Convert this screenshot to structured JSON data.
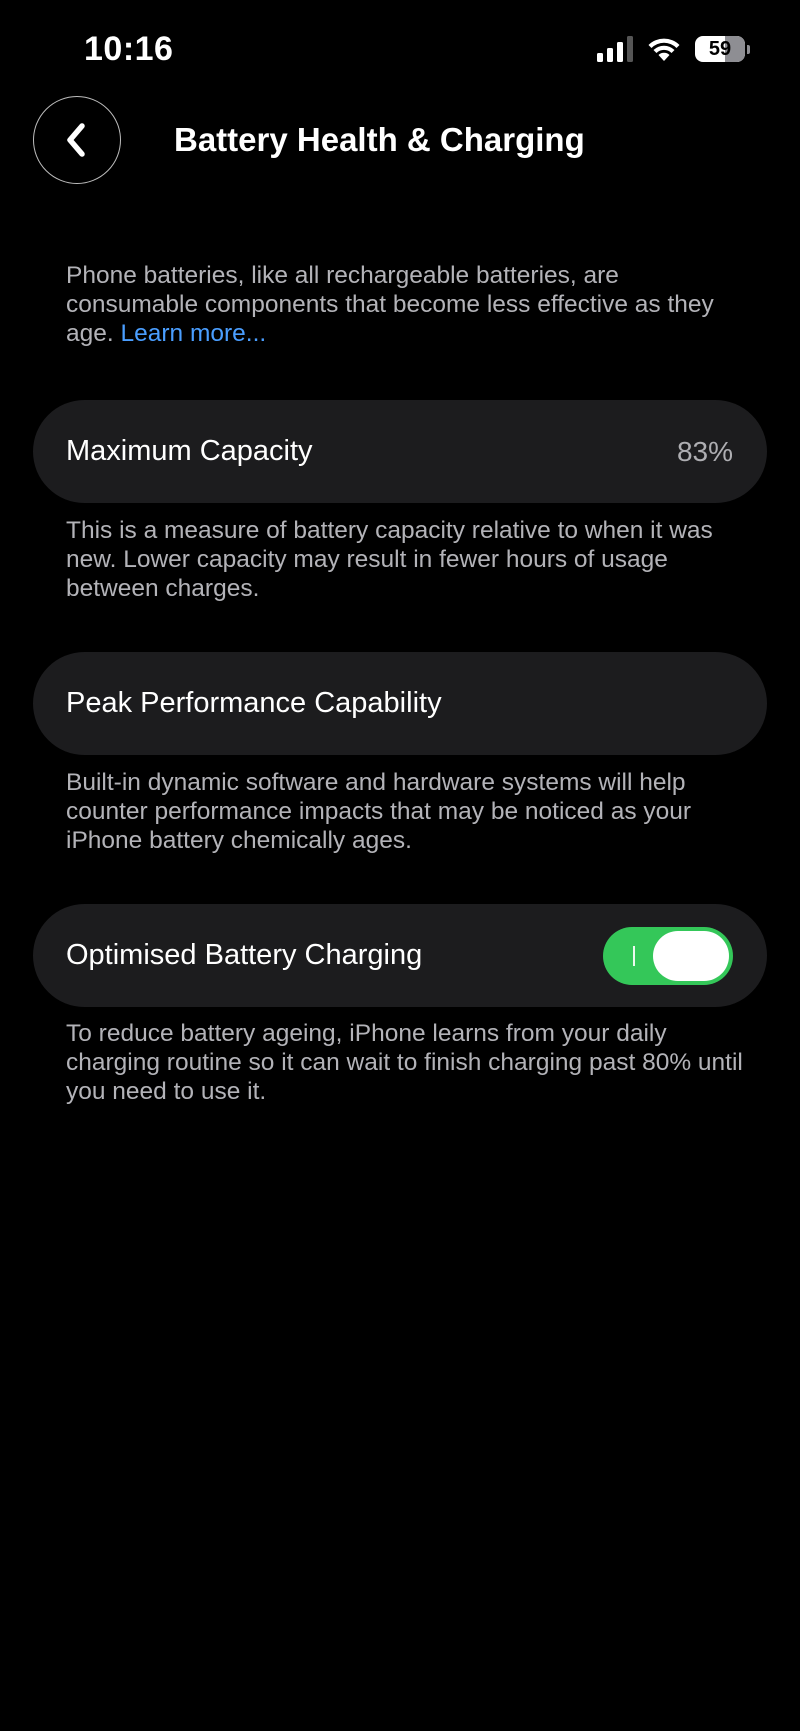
{
  "status_bar": {
    "time": "10:16",
    "battery_level": "59",
    "icons": [
      "cellular-signal-icon",
      "wifi-icon",
      "battery-icon"
    ]
  },
  "nav": {
    "back_icon": "chevron-left-icon",
    "title": "Battery Health & Charging"
  },
  "intro": {
    "text": "Phone batteries, like all rechargeable batteries, are consumable components that become less effective as they age. ",
    "link": "Learn more..."
  },
  "maximum_capacity": {
    "label": "Maximum Capacity",
    "value": "83%",
    "description": "This is a measure of battery capacity relative to when it was new. Lower capacity may result in fewer hours of usage between charges."
  },
  "peak_performance": {
    "label": "Peak Performance Capability",
    "description": "Built-in dynamic software and hardware systems will help counter performance impacts that may be noticed as your iPhone battery chemically ages."
  },
  "optimised_charging": {
    "label": "Optimised Battery Charging",
    "enabled": true,
    "description": "To reduce battery ageing, iPhone learns from your daily charging routine so it can wait to finish charging past 80% until you need to use it."
  },
  "colors": {
    "background": "#000000",
    "card": "#1c1c1e",
    "secondary_text": "#b3b3b8",
    "link": "#4a9eff",
    "toggle_on": "#34c759"
  }
}
